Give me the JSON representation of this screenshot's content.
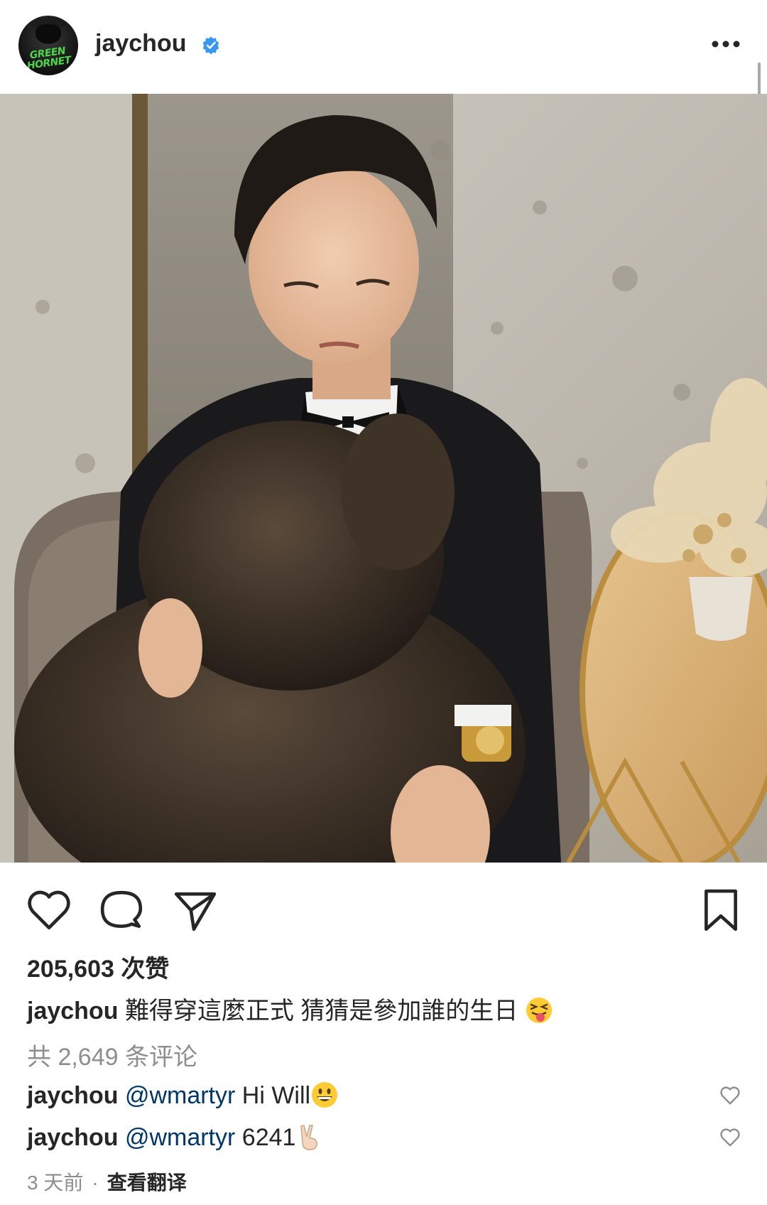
{
  "post": {
    "username": "jaychou",
    "verified": true,
    "avatar_logo_text": "GREEN HORNET",
    "photo_description_icon": "photo",
    "likes_text": "205,603 次赞",
    "caption": {
      "username": "jaychou",
      "text": "難得穿這麼正式 猜猜是參加誰的生日",
      "emoji": "squinting-tongue-face"
    },
    "comments_count_text": "共 2,649 条评论",
    "comments": [
      {
        "username": "jaychou",
        "mention": "@wmartyr",
        "text": "Hi Will",
        "emoji": "grinning-face"
      },
      {
        "username": "jaychou",
        "mention": "@wmartyr",
        "text": "6241",
        "emoji": "victory-hand"
      }
    ],
    "time_ago": "3 天前",
    "separator": "·",
    "translate_label": "查看翻译"
  },
  "icons": {
    "more": "more-dots-icon",
    "like": "heart-icon",
    "comment": "comment-bubble-icon",
    "share": "paper-plane-icon",
    "save": "bookmark-icon"
  },
  "colors": {
    "verified_blue": "#3897f0",
    "text_primary": "#262626",
    "text_secondary": "#8e8e8e",
    "mention": "#00376b"
  }
}
